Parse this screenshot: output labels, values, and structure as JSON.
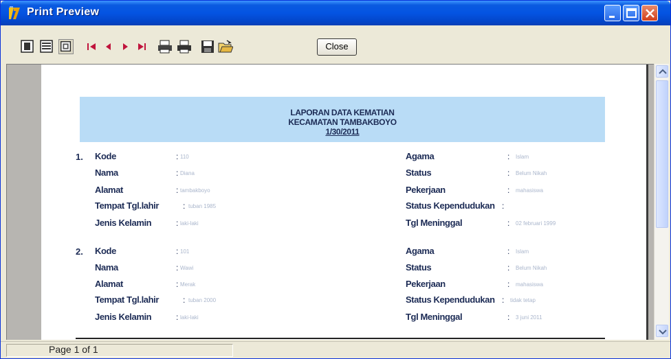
{
  "window": {
    "title": "Print Preview"
  },
  "toolbar": {
    "close_label": "Close"
  },
  "status": {
    "page": "Page 1 of 1"
  },
  "report": {
    "title": "LAPORAN DATA KEMATIAN",
    "subtitle": "KECAMATAN TAMBAKBOYO",
    "date": "1/30/2011"
  },
  "labels": {
    "kode": "Kode",
    "nama": "Nama",
    "alamat": "Alamat",
    "ttl": "Tempat Tgl.lahir",
    "jk": "Jenis Kelamin",
    "agama": "Agama",
    "status": "Status",
    "pekerjaan": "Pekerjaan",
    "status_kependudukan": "Status Kependudukan",
    "tgl_meninggal": "Tgl Meninggal"
  },
  "records": [
    {
      "no": "1.",
      "kode": "110",
      "nama": "Diana",
      "alamat": "tambakboyo",
      "ttl": "tuban 1985",
      "jk": "laki-laki",
      "agama": "Islam",
      "status": "Belum Nikah",
      "pekerjaan": "mahasiswa",
      "status_kependudukan": "",
      "tgl_meninggal": "02 februari 1999"
    },
    {
      "no": "2.",
      "kode": "101",
      "nama": "Wawi",
      "alamat": "Merak",
      "ttl": "tuban 2000",
      "jk": "laki-laki",
      "agama": "Islam",
      "status": "Belum Nikah",
      "pekerjaan": "mahasiswa",
      "status_kependudukan": "tidak tetap",
      "tgl_meninggal": "3 juni 2011"
    }
  ],
  "colors": {
    "banner": "#b9dcf6",
    "titlebar": "#0454e2",
    "label_text": "#1c2b55"
  }
}
